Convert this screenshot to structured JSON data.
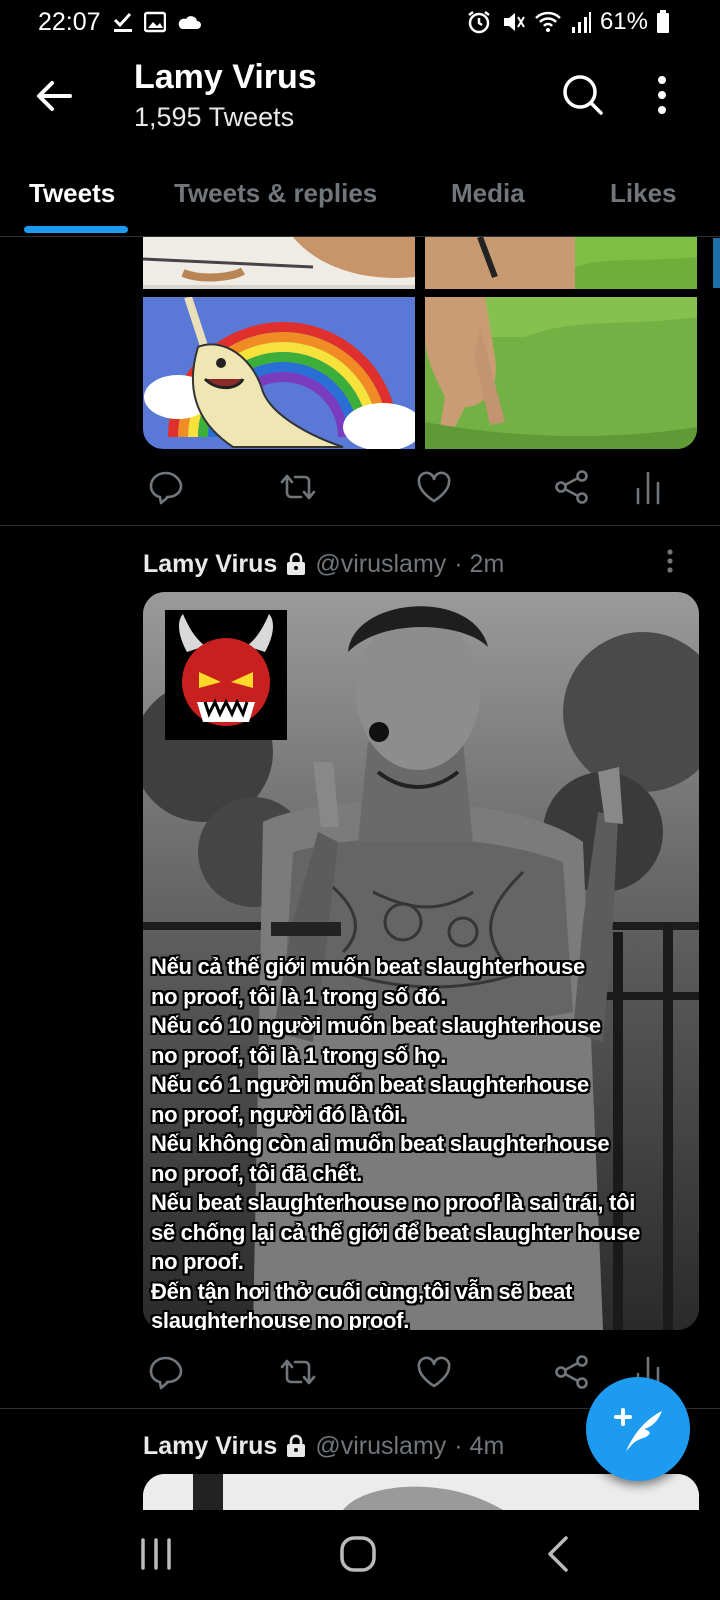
{
  "status_bar": {
    "time": "22:07",
    "battery": "61%"
  },
  "header": {
    "title": "Lamy Virus",
    "subtitle": "1,595 Tweets"
  },
  "tabs": [
    {
      "label": "Tweets",
      "active": true
    },
    {
      "label": "Tweets & replies",
      "active": false
    },
    {
      "label": "Media",
      "active": false
    },
    {
      "label": "Likes",
      "active": false
    }
  ],
  "tweets": [
    {
      "name": "Lamy Virus",
      "handle": "@viruslamy",
      "time": "· 2m",
      "meme_lines": [
        "Nếu cả thế giới muốn beat slaughterhouse",
        "no proof, tôi là 1 trong số đó.",
        "Nếu có 10 người muốn beat slaughterhouse",
        "no proof, tôi là 1 trong số họ.",
        "Nếu có 1 người muốn beat slaughterhouse",
        "no proof, người đó là tôi.",
        "Nếu không còn ai muốn beat slaughterhouse",
        "no proof, tôi đã chết.",
        "Nếu beat slaughterhouse no proof là sai trái, tôi",
        "sẽ chống lại cả thế giới để beat slaughter house",
        "no proof.",
        "Đến tận hơi thở cuối cùng,tôi vẫn sẽ beat",
        "slaughterhouse no proof."
      ]
    },
    {
      "name": "Lamy Virus",
      "handle": "@viruslamy",
      "time": "· 4m"
    }
  ],
  "colors": {
    "accent": "#1d9bf0",
    "background": "#000000",
    "secondary_text": "#71767b",
    "divider": "#2f3336"
  },
  "icons": {
    "back": "arrow-left-icon",
    "search": "search-icon",
    "more": "more-vertical-icon",
    "reply": "reply-icon",
    "retweet": "retweet-icon",
    "like": "heart-icon",
    "share": "share-icon",
    "analytics": "analytics-icon",
    "lock": "lock-icon",
    "compose": "compose-tweet-icon"
  }
}
